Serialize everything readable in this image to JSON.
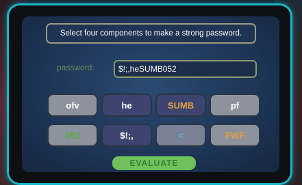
{
  "prompt": "Select four components to make a strong password.",
  "password": {
    "label": "password:",
    "value": "$!;,heSUMB052"
  },
  "keys": {
    "row1": [
      "ofv",
      "he",
      "SUMB",
      "pf"
    ],
    "row2": [
      "052",
      "$!;,",
      "<",
      "FWF"
    ]
  },
  "evaluate_label": "EVALUATE",
  "colors": {
    "frame_glow": "#1ab6c8",
    "screen": "#2b4a73",
    "key_gray": "#8d939d",
    "key_navy": "#3d4470",
    "highlight_orange": "#e0a040",
    "evaluate_green": "#6fc15a"
  }
}
